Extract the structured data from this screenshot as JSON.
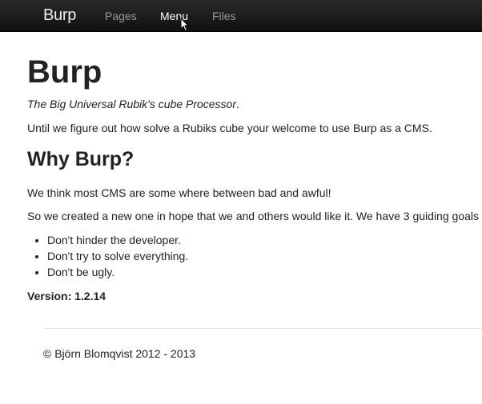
{
  "navbar": {
    "brand": "Burp",
    "links": [
      {
        "label": "Pages",
        "active": false
      },
      {
        "label": "Menu",
        "active": true
      },
      {
        "label": "Files",
        "active": false
      }
    ]
  },
  "main": {
    "title": "Burp",
    "tagline_italic": "The Big Universal Rubik's cube Processor",
    "tagline_suffix": ".",
    "intro": "Until we figure out how solve a Rubiks cube your welcome to use Burp as a CMS.",
    "section_title": "Why Burp?",
    "paragraph1": "We think most CMS are some where between bad and awful!",
    "paragraph2": "So we created a new one in hope that we and others would like it. We have 3 guiding goals",
    "goals": [
      "Don't hinder the developer.",
      "Don't try to solve everything.",
      "Don't be ugly."
    ],
    "version": "Version: 1.2.14"
  },
  "footer": {
    "text": "© Björn Blomqvist 2012 - 2013"
  },
  "colors": {
    "navbar_bg": "#1a1a1a",
    "nav_link": "#9a9a9a",
    "nav_link_active": "#ffffff",
    "text": "#222222"
  }
}
